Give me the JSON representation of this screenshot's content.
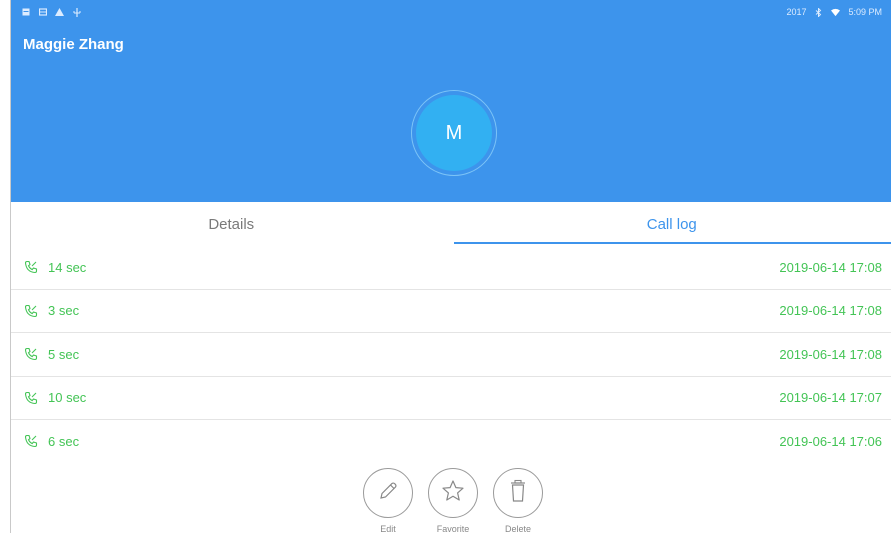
{
  "status_bar": {
    "year": "2017",
    "time": "5:09 PM"
  },
  "contact": {
    "name": "Maggie Zhang",
    "initial": "M"
  },
  "tabs": [
    {
      "label": "Details",
      "active": false
    },
    {
      "label": "Call log",
      "active": true
    }
  ],
  "call_log": [
    {
      "duration": "14 sec",
      "timestamp": "2019-06-14 17:08"
    },
    {
      "duration": "3 sec",
      "timestamp": "2019-06-14 17:08"
    },
    {
      "duration": "5 sec",
      "timestamp": "2019-06-14 17:08"
    },
    {
      "duration": "10 sec",
      "timestamp": "2019-06-14 17:07"
    },
    {
      "duration": "6 sec",
      "timestamp": "2019-06-14 17:06"
    }
  ],
  "actions": [
    {
      "label": "Edit",
      "icon": "pencil-icon"
    },
    {
      "label": "Favorite",
      "icon": "star-icon"
    },
    {
      "label": "Delete",
      "icon": "trash-icon"
    }
  ],
  "colors": {
    "header": "#3d94ec",
    "avatar": "#32b0f2",
    "call_green": "#43c455",
    "tab_active": "#3d94ec"
  }
}
